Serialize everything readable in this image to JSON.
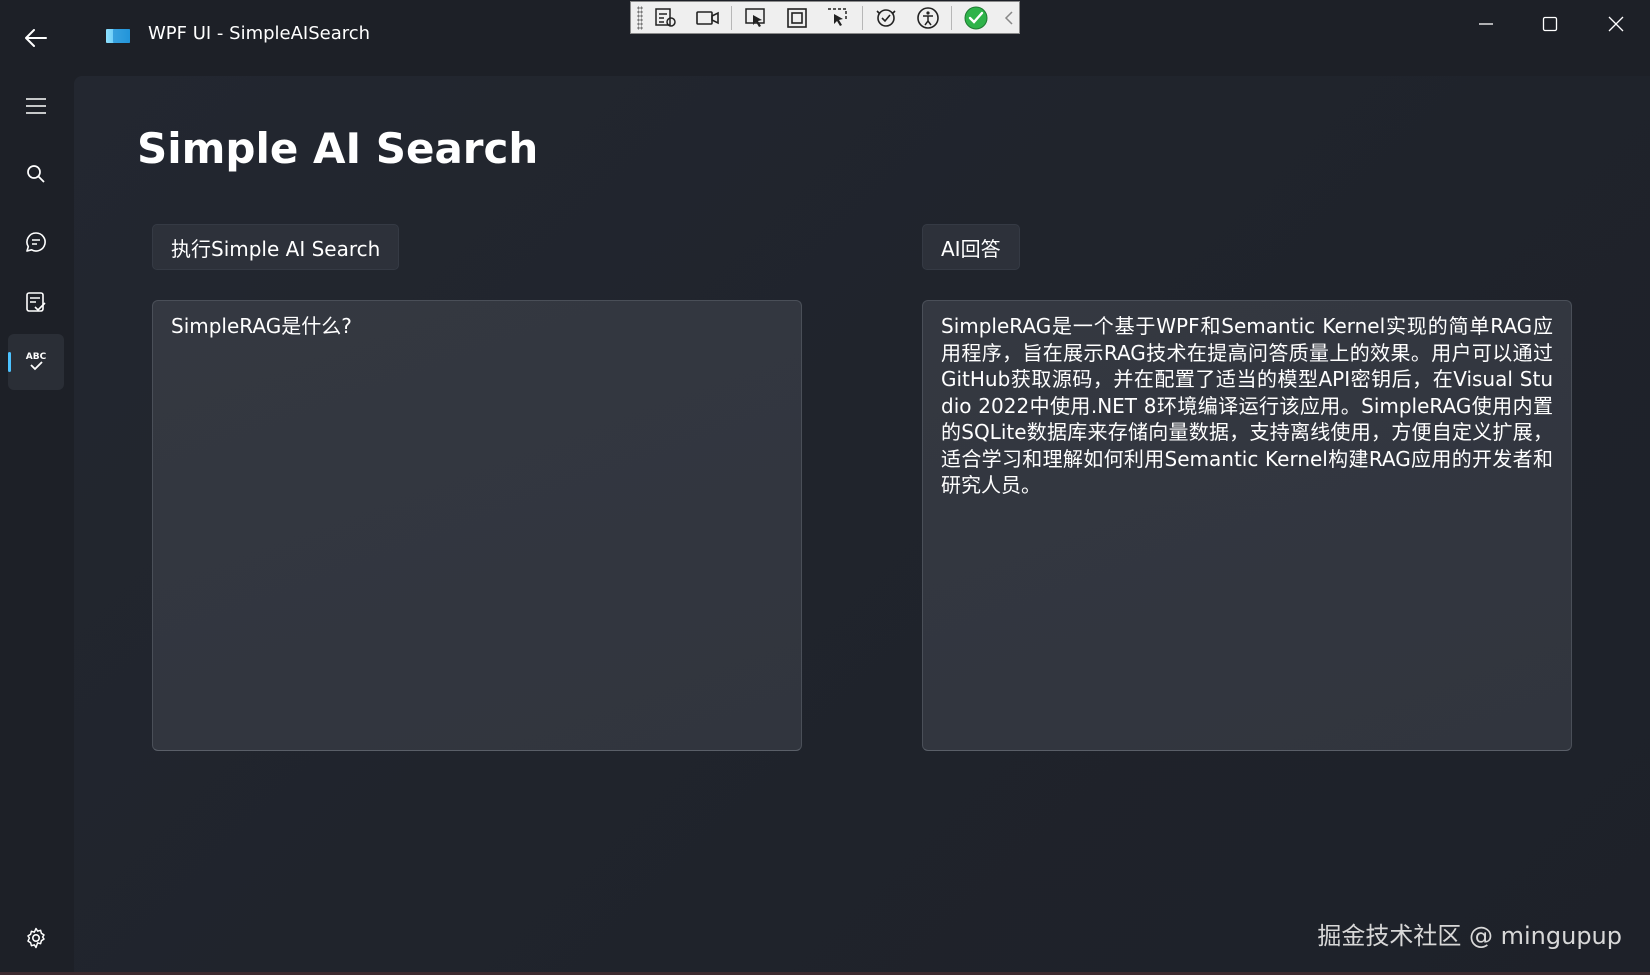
{
  "window": {
    "title": "WPF UI - SimpleAISearch"
  },
  "nav": {
    "items": [
      {
        "icon": "hamburger-menu-icon"
      },
      {
        "icon": "search-icon"
      },
      {
        "icon": "chat-icon"
      },
      {
        "icon": "task-list-icon"
      },
      {
        "icon": "spellcheck-abc-icon",
        "label": "ABC",
        "active": true
      }
    ],
    "settings_icon": "gear-icon"
  },
  "page": {
    "title": "Simple AI Search",
    "search_button": "执行Simple AI Search",
    "answer_button": "AI回答",
    "query_value": "SimpleRAG是什么?",
    "answer_value": "SimpleRAG是一个基于WPF和Semantic Kernel实现的简单RAG应用程序，旨在展示RAG技术在提高问答质量上的效果。用户可以通过GitHub获取源码，并在配置了适当的模型API密钥后，在Visual Studio 2022中使用.NET 8环境编译运行该应用。SimpleRAG使用内置的SQLite数据库来存储向量数据，支持离线使用，方便自定义扩展，适合学习和理解如何利用Semantic Kernel构建RAG应用的开发者和研究人员。"
  },
  "watermark": "掘金技术社区 @ mingupup",
  "colors": {
    "accent": "#4cc2ff",
    "background": "#1d2027",
    "textbox": "#343841",
    "button": "#2d313a"
  }
}
